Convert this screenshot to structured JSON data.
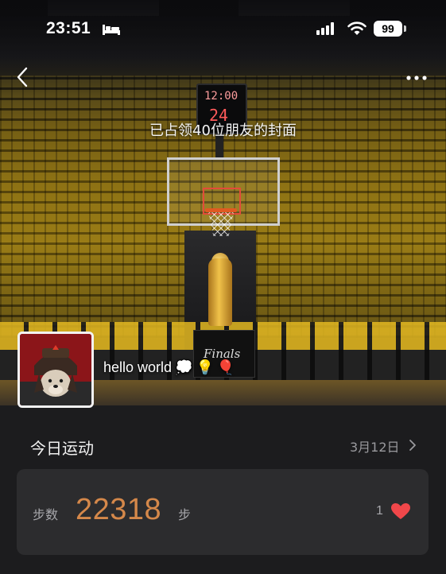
{
  "status_bar": {
    "time": "23:51",
    "battery": "99",
    "icons": [
      "bed-icon",
      "signal-icon",
      "wifi-icon",
      "battery-icon"
    ]
  },
  "nav": {
    "back_icon": "chevron-left-icon",
    "more_icon": "more-dots-icon"
  },
  "cover": {
    "occupy_text": "已占领40位朋友的封面",
    "shotclock_top": "12:00",
    "shotclock_bottom": "24",
    "finals_text": "Finals"
  },
  "profile": {
    "status_text": "hello world",
    "status_emojis": [
      "💭",
      "💡",
      "🎈"
    ]
  },
  "today": {
    "title": "今日运动",
    "date": "3月12日"
  },
  "steps_card": {
    "label": "步数",
    "value": "22318",
    "unit": "步",
    "likes": "1",
    "heart_color": "#f0474a",
    "value_color": "#d5884a"
  }
}
